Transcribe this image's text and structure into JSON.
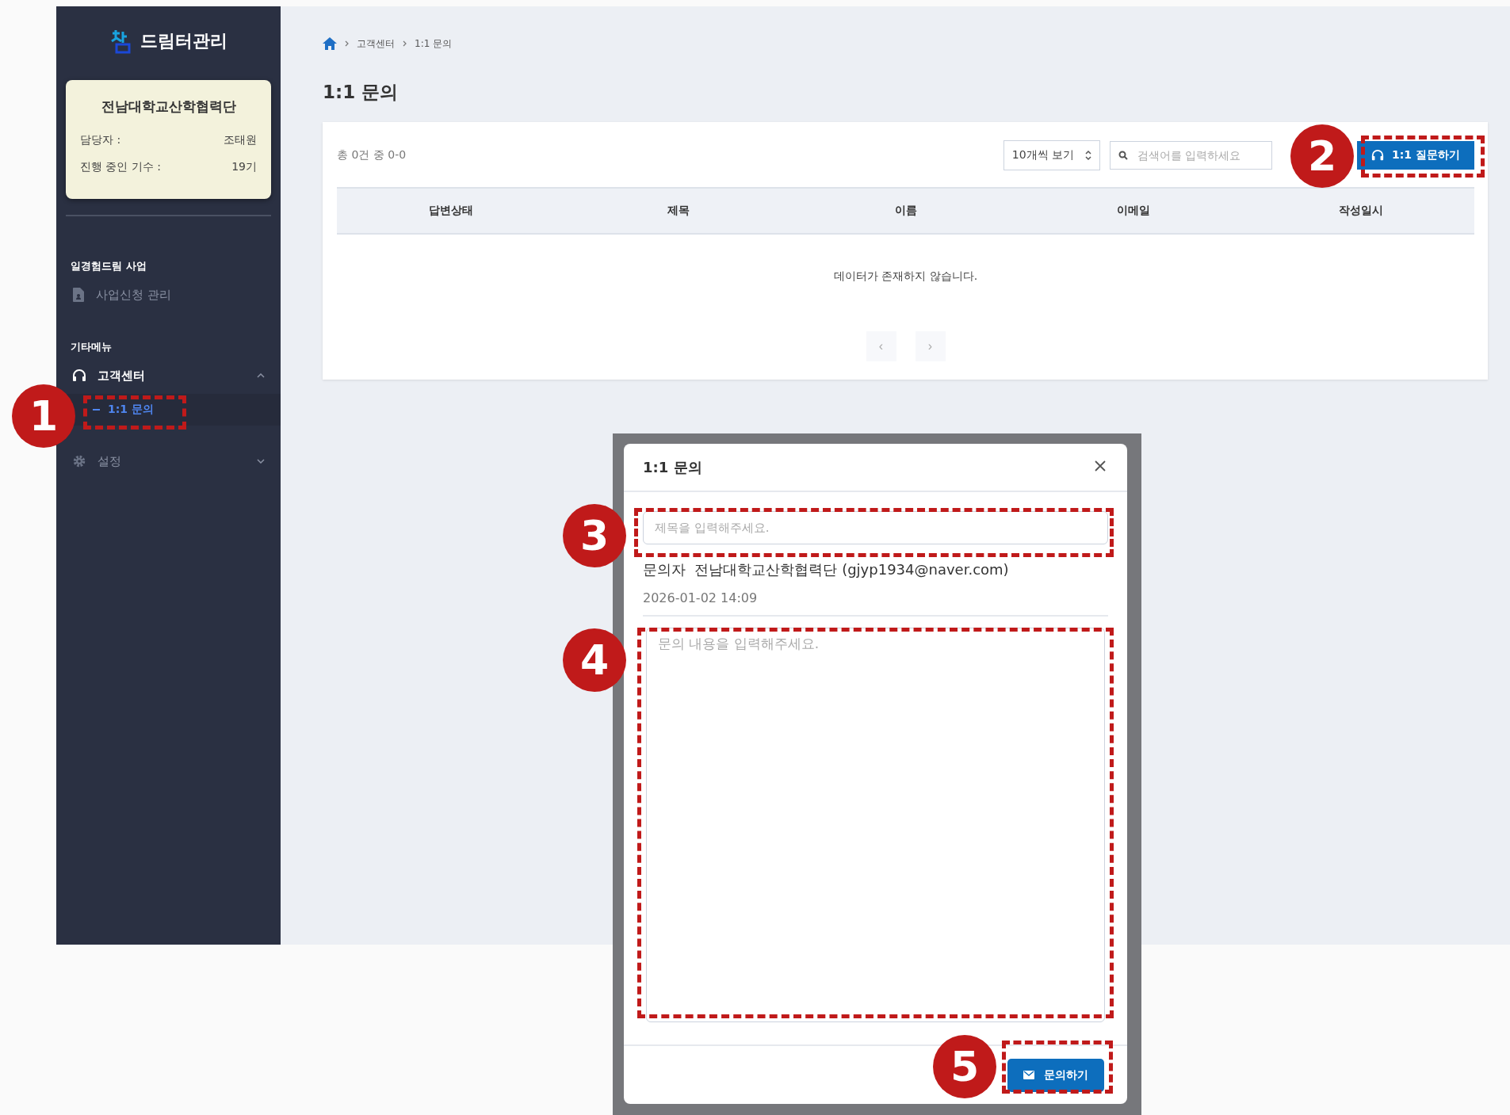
{
  "sidebar": {
    "logo": "드림터관리",
    "org_card": {
      "name": "전남대학교산학협력단",
      "rows": [
        {
          "label": "담당자 :",
          "value": "조태원"
        },
        {
          "label": "진행 중인 기수 :",
          "value": "19기"
        }
      ]
    },
    "sections": [
      {
        "title": "일경험드림 사업",
        "items": [
          {
            "label": "사업신청 관리"
          }
        ]
      },
      {
        "title": "기타메뉴",
        "items": [
          {
            "label": "고객센터",
            "expanded": true,
            "children": [
              {
                "label": "1:1 문의",
                "selected": true
              }
            ]
          },
          {
            "label": "설정",
            "expanded": false
          }
        ]
      }
    ]
  },
  "main": {
    "breadcrumb": [
      "고객센터",
      "1:1 문의"
    ],
    "page_title": "1:1 문의",
    "summary": "총 0건 중 0-0",
    "page_size": "10개씩 보기",
    "search": {
      "placeholder": "검색어를 입력하세요"
    },
    "ask_button": "1:1 질문하기",
    "table": {
      "columns": [
        "답변상태",
        "제목",
        "이름",
        "이메일",
        "작성일시"
      ],
      "empty_message": "데이터가 존재하지 않습니다."
    },
    "pagination": [
      "‹",
      "›"
    ]
  },
  "modal": {
    "title": "1:1 문의",
    "subject": {
      "placeholder": "제목을 입력해주세요."
    },
    "inquirer_label": "문의자",
    "inquirer": "전남대학교산학협력단 (gjyp1934@naver.com)",
    "date": "2026-01-02 14:09",
    "content": {
      "placeholder": "문의 내용을 입력해주세요."
    },
    "submit": "문의하기"
  },
  "callouts": [
    {
      "number": "1"
    },
    {
      "number": "2"
    },
    {
      "number": "3"
    },
    {
      "number": "4"
    },
    {
      "number": "5"
    }
  ]
}
